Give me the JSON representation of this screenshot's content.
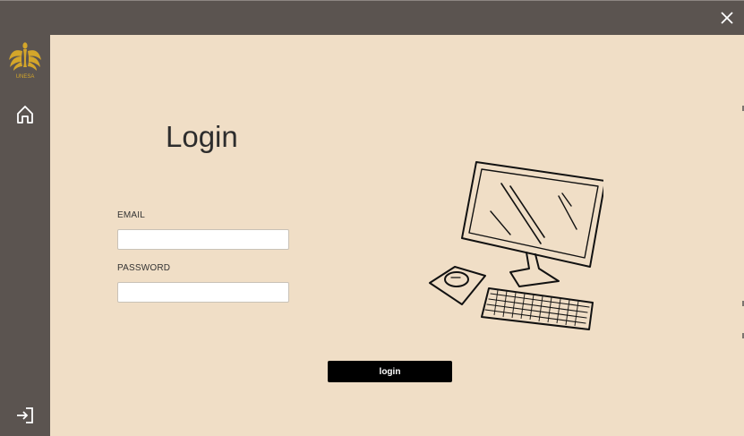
{
  "window": {
    "close_icon": "close-icon"
  },
  "sidebar": {
    "logo_text": "UNESA",
    "logo_color": "#d4a62a",
    "home_icon": "home-icon",
    "logout_icon": "logout-icon"
  },
  "main": {
    "title": "Login",
    "email_label": "EMAIL",
    "email_value": "",
    "password_label": "PASSWORD",
    "password_value": "",
    "login_button": "login",
    "illustration": "computer-illustration"
  },
  "colors": {
    "background": "#f0dec6",
    "sidebar": "#5b5450",
    "button": "#000000"
  }
}
